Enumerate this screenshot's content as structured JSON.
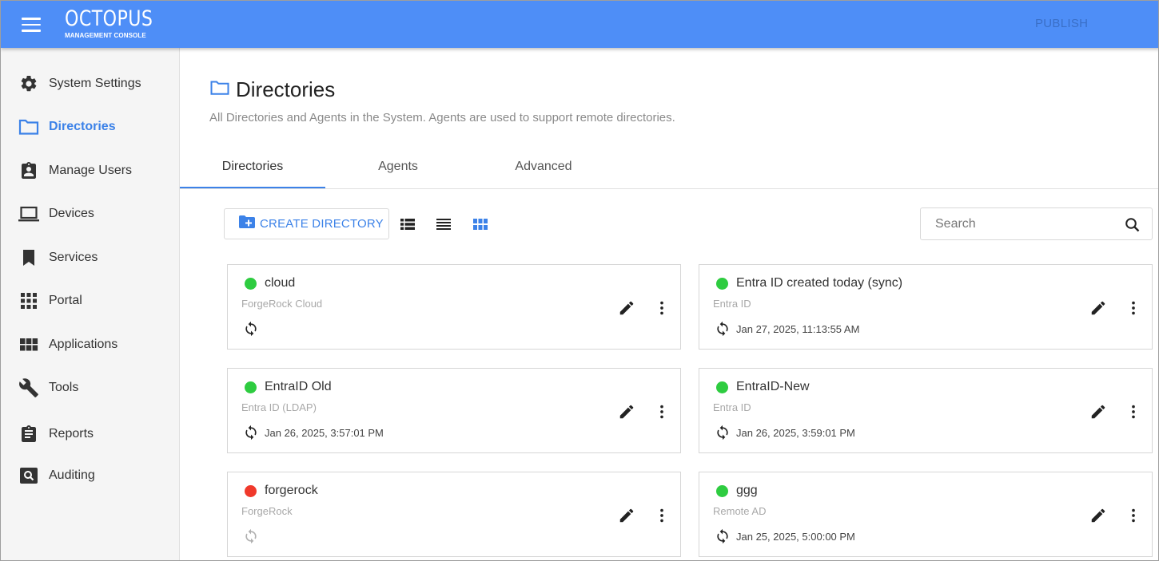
{
  "header": {
    "logo_title": "OCTOPUS",
    "logo_subtitle": "MANAGEMENT CONSOLE",
    "publish_label": "PUBLISH"
  },
  "sidebar": {
    "items": [
      {
        "label": "System Settings",
        "icon": "gear-icon"
      },
      {
        "label": "Directories",
        "icon": "folder-icon",
        "active": true
      },
      {
        "label": "Manage Users",
        "icon": "user-badge-icon"
      },
      {
        "label": "Devices",
        "icon": "laptop-icon"
      },
      {
        "label": "Services",
        "icon": "bookmark-icon"
      },
      {
        "label": "Portal",
        "icon": "apps-grid-icon"
      },
      {
        "label": "Applications",
        "icon": "view-module-icon"
      },
      {
        "label": "Tools",
        "icon": "wrench-icon"
      },
      {
        "label": "Reports",
        "icon": "clipboard-icon"
      },
      {
        "label": "Auditing",
        "icon": "search-box-icon"
      }
    ]
  },
  "page": {
    "title": "Directories",
    "subtitle": "All Directories and Agents in the System. Agents are used to support remote directories."
  },
  "tabs": [
    {
      "label": "Directories",
      "active": true
    },
    {
      "label": "Agents"
    },
    {
      "label": "Advanced"
    }
  ],
  "toolbar": {
    "create_label": "CREATE DIRECTORY",
    "search_placeholder": "Search",
    "active_view": "grid"
  },
  "directories": [
    {
      "name": "cloud",
      "type": "ForgeRock Cloud",
      "status": "online",
      "last_sync": ""
    },
    {
      "name": "Entra ID created today (sync)",
      "type": "Entra ID",
      "status": "online",
      "last_sync": "Jan 27, 2025, 11:13:55 AM"
    },
    {
      "name": "EntraID Old",
      "type": "Entra ID (LDAP)",
      "status": "online",
      "last_sync": "Jan 26, 2025, 3:57:01 PM"
    },
    {
      "name": "EntraID-New",
      "type": "Entra ID",
      "status": "online",
      "last_sync": "Jan 26, 2025, 3:59:01 PM"
    },
    {
      "name": "forgerock",
      "type": "ForgeRock",
      "status": "offline",
      "last_sync": ""
    },
    {
      "name": "ggg",
      "type": "Remote AD",
      "status": "online",
      "last_sync": "Jan 25, 2025, 5:00:00 PM"
    }
  ],
  "colors": {
    "header": "#4e8ef7",
    "accent": "#3c82e8",
    "status_online": "#2ecc40",
    "status_offline": "#f0392b"
  }
}
